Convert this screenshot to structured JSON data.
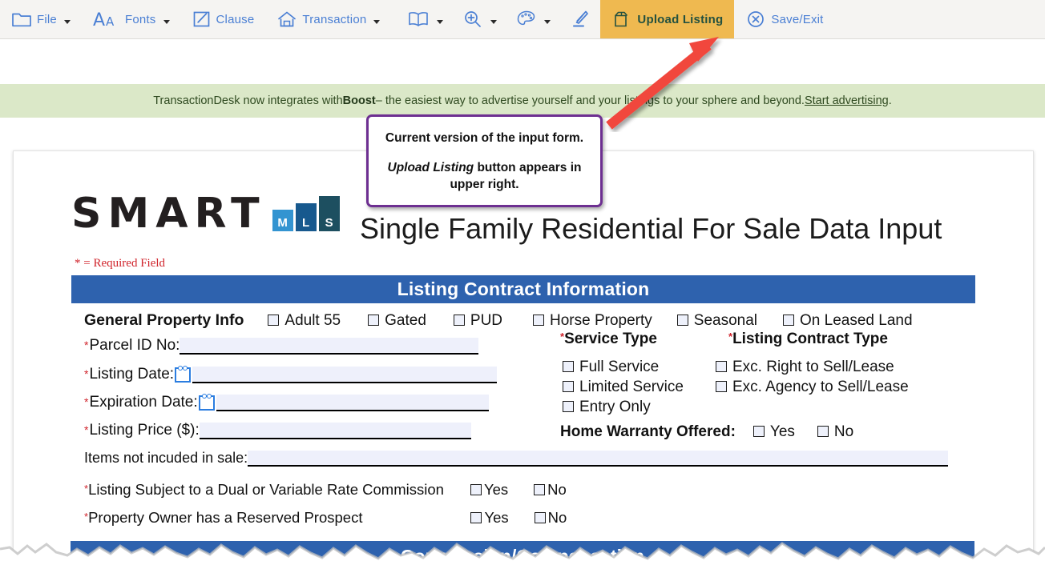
{
  "toolbar": {
    "items": [
      {
        "label": "File",
        "icon": "folder-icon",
        "caret": true
      },
      {
        "label": "Fonts",
        "icon": "fonts-icon",
        "caret": true
      },
      {
        "label": "Clause",
        "icon": "clause-icon",
        "caret": false
      },
      {
        "label": "Transaction",
        "icon": "house-icon",
        "caret": true
      },
      {
        "label": "",
        "icon": "book-icon",
        "caret": true
      },
      {
        "label": "",
        "icon": "zoom-in-icon",
        "caret": true
      },
      {
        "label": "",
        "icon": "palette-icon",
        "caret": true
      },
      {
        "label": "",
        "icon": "pen-icon",
        "caret": false
      },
      {
        "label": "Upload Listing",
        "icon": "upload-box-icon",
        "caret": false
      },
      {
        "label": "Save/Exit",
        "icon": "close-circle-icon",
        "caret": false
      }
    ],
    "highlight_color": "#efb950",
    "icon_color": "#4a7fd4"
  },
  "promo": {
    "text_before": "TransactionDesk now integrates with ",
    "brand": "Boost",
    "text_after": " – the easiest way to advertise yourself and your listings to your sphere and beyond. ",
    "link": "Start advertising",
    "text_end": ".",
    "background": "#dbe8c8"
  },
  "callout": {
    "line1": "Current version of the input form.",
    "line2_em": "Upload Listing",
    "line2_rest": " button appears in upper right.",
    "border_color": "#6d2f91"
  },
  "document": {
    "logo": {
      "word": "SMART",
      "blocks": [
        "M",
        "L",
        "S"
      ]
    },
    "title": "Single Family Residential For Sale Data Input",
    "required_note": "* = Required Field",
    "section_bar": "Listing Contract Information",
    "section_bar_color": "#2e62ae",
    "general": {
      "heading": "General Property Info",
      "options": [
        "Adult 55",
        "Gated",
        "PUD",
        "Horse Property",
        "Seasonal",
        "On Leased Land"
      ]
    },
    "fields": [
      {
        "label": "Parcel ID No:",
        "required": true,
        "value": "",
        "calendar": false
      },
      {
        "label": "Listing Date:",
        "required": true,
        "value": "",
        "calendar": true
      },
      {
        "label": "Expiration Date:",
        "required": true,
        "value": "",
        "calendar": true
      },
      {
        "label": "Listing Price ($):",
        "required": true,
        "value": "",
        "calendar": false
      }
    ],
    "items_not_included": {
      "label": "Items not incuded in sale:",
      "value": ""
    },
    "service_type": {
      "heading": "Service Type",
      "required": true,
      "options": [
        "Full Service",
        "Limited Service",
        "Entry Only"
      ]
    },
    "listing_contract_type": {
      "heading": "Listing Contract Type",
      "required": true,
      "options": [
        "Exc. Right to Sell/Lease",
        "Exc. Agency to Sell/Lease"
      ]
    },
    "home_warranty": {
      "label": "Home Warranty Offered:",
      "yes": "Yes",
      "no": "No"
    },
    "yes_no_rows": [
      {
        "label": "Listing Subject to a Dual or Variable Rate Commission",
        "yes": "Yes",
        "no": "No",
        "required": true
      },
      {
        "label": "Property Owner has a Reserved Prospect",
        "yes": "Yes",
        "no": "No",
        "required": true
      }
    ],
    "next_section_bar": "Commission/Compensation"
  }
}
